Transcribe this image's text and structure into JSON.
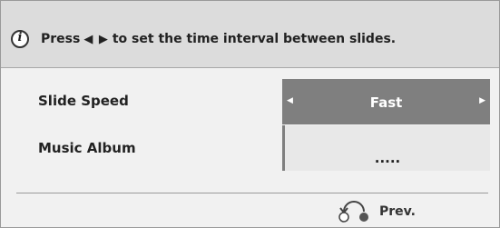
{
  "info": {
    "icon": "info-icon",
    "icon_glyph": "i",
    "text_before": "Press",
    "arrows": "◀ ▶",
    "text_after": "to set the time interval between slides."
  },
  "settings": [
    {
      "label": "Slide Speed",
      "value": "Fast"
    },
    {
      "label": "Music Album",
      "value": "....."
    }
  ],
  "footer": {
    "prev_icon": "return-icon",
    "prev_label": "Prev."
  },
  "colors": {
    "selected_bg": "#7f7f7f",
    "panel_bg": "#f1f1f1",
    "info_bg": "#dcdcdc"
  }
}
